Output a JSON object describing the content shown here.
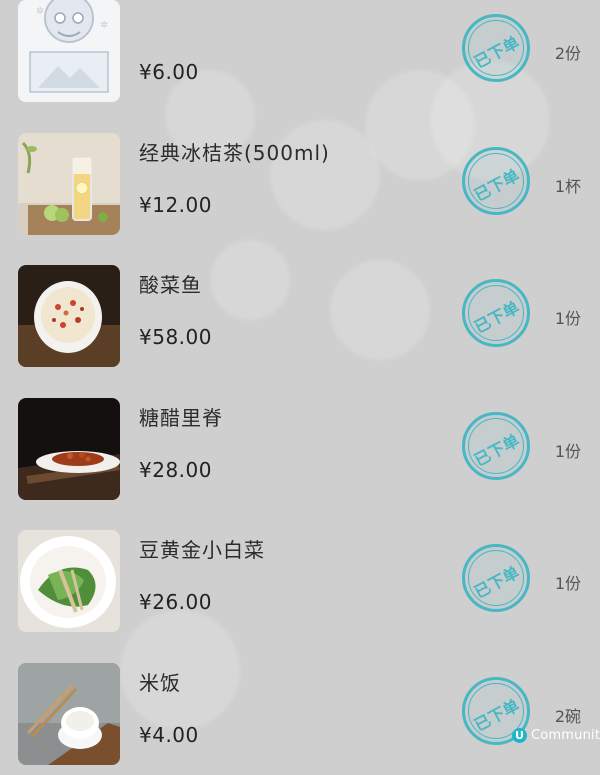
{
  "colors": {
    "background": "#cfcfcf",
    "stamp": "#48b7c4",
    "text": "#2b2b2b"
  },
  "items": [
    {
      "name": "",
      "price": "¥6.00",
      "status": "已下单",
      "quantity": "2份"
    },
    {
      "name": "经典冰桔茶(500ml)",
      "price": "¥12.00",
      "status": "已下单",
      "quantity": "1杯"
    },
    {
      "name": "酸菜鱼",
      "price": "¥58.00",
      "status": "已下单",
      "quantity": "1份"
    },
    {
      "name": "糖醋里脊",
      "price": "¥28.00",
      "status": "已下单",
      "quantity": "1份"
    },
    {
      "name": "豆黄金小白菜",
      "price": "¥26.00",
      "status": "已下单",
      "quantity": "1份"
    },
    {
      "name": "米饭",
      "price": "¥4.00",
      "status": "已下单",
      "quantity": "2碗"
    }
  ],
  "watermark": {
    "badge": "U",
    "text": "Community"
  }
}
